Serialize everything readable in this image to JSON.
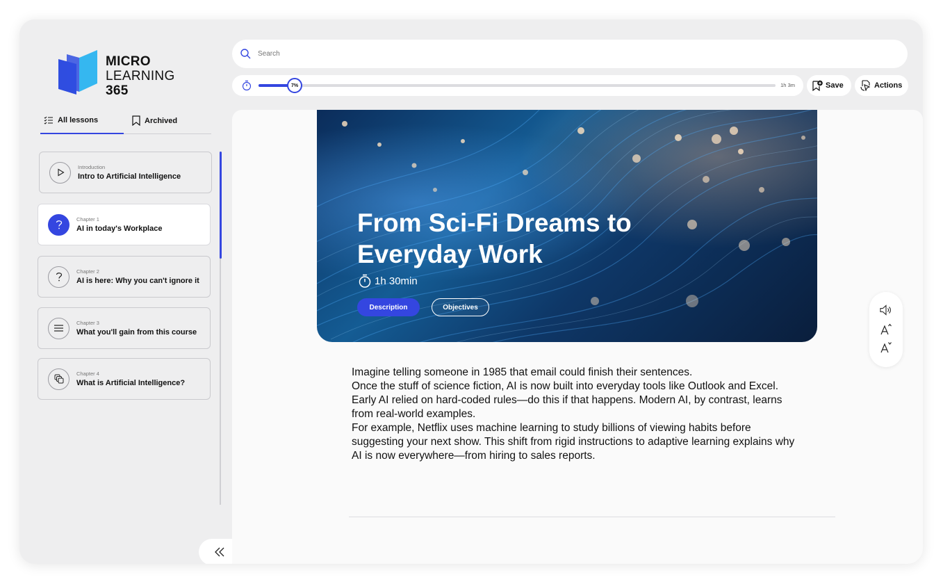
{
  "brand": {
    "line1": "MICRO",
    "line2": "LEARNING",
    "line3": "365",
    "color": "#2f4de0",
    "accent": "#35b7f0"
  },
  "tabs": [
    {
      "label": "All lessons",
      "icon": "list-check-icon"
    },
    {
      "label": "Archived",
      "icon": "bookmark-icon"
    }
  ],
  "lessons": [
    {
      "kicker": "Introduction",
      "title": "Intro to Artificial Intelligence",
      "icon": "play-icon"
    },
    {
      "kicker": "Chapter 1",
      "title": "AI in today's Workplace",
      "icon": "question-icon"
    },
    {
      "kicker": "Chapter 2",
      "title": "AI is here: Why you can't ignore it",
      "icon": "question-icon"
    },
    {
      "kicker": "Chapter 3",
      "title": "What you'll gain from this course",
      "icon": "menu-lines-icon"
    },
    {
      "kicker": "Chapter 4",
      "title": "What is Artificial Intelligence?",
      "icon": "layers-icon"
    }
  ],
  "search": {
    "placeholder": "Search"
  },
  "progress": {
    "value_percent": 7,
    "label": "7%",
    "duration": "1h 3m"
  },
  "toolbar": {
    "save_label": "Save",
    "actions_label": "Actions"
  },
  "hero": {
    "title": "From Sci-Fi Dreams to Everyday Work",
    "duration": "1h 30min",
    "description_label": "Description",
    "objectives_label": "Objectives"
  },
  "body": {
    "paragraphs": [
      "Imagine telling someone in 1985 that email could finish their sentences.",
      "Once the stuff of science fiction, AI is now built into everyday tools like Outlook and Excel. Early AI relied on hard-coded rules—do this if that happens. Modern AI, by contrast, learns from real-world examples.",
      "For example, Netflix uses machine learning to study billions of viewing habits before suggesting your next show. This shift from rigid instructions to adaptive learning explains why AI is now everywhere—from hiring to sales reports."
    ]
  },
  "colors": {
    "accent": "#3446e0",
    "frame": "#eeeeef"
  }
}
